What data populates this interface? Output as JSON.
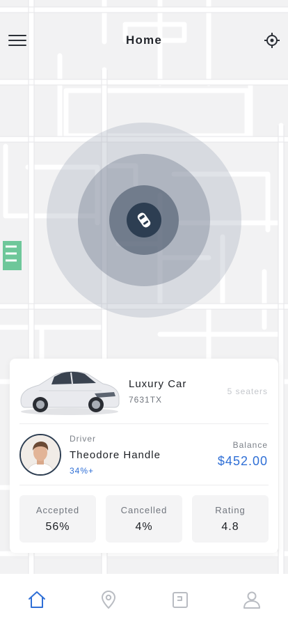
{
  "header": {
    "title": "Home",
    "menu_icon": "hamburger-menu-icon",
    "locate_icon": "crosshair-locate-icon"
  },
  "map": {
    "marker_icon": "car-top-view-icon"
  },
  "vehicle": {
    "name": "Luxury Car",
    "plate": "7631TX",
    "seaters": "5 seaters"
  },
  "driver": {
    "label": "Driver",
    "name": "Theodore Handle",
    "percent": "34%+"
  },
  "balance": {
    "label": "Balance",
    "value": "$452.00"
  },
  "stats": [
    {
      "label": "Accepted",
      "value": "56%"
    },
    {
      "label": "Cancelled",
      "value": "4%"
    },
    {
      "label": "Rating",
      "value": "4.8"
    }
  ],
  "tabbar": {
    "tabs": [
      {
        "icon": "home-icon",
        "active": true
      },
      {
        "icon": "location-pin-icon",
        "active": false
      },
      {
        "icon": "wallet-icon",
        "active": false
      },
      {
        "icon": "profile-icon",
        "active": false
      }
    ]
  },
  "colors": {
    "accent": "#2f6fd6",
    "marker": "#2d3e52",
    "inactive_icon": "#b9bcc2"
  }
}
